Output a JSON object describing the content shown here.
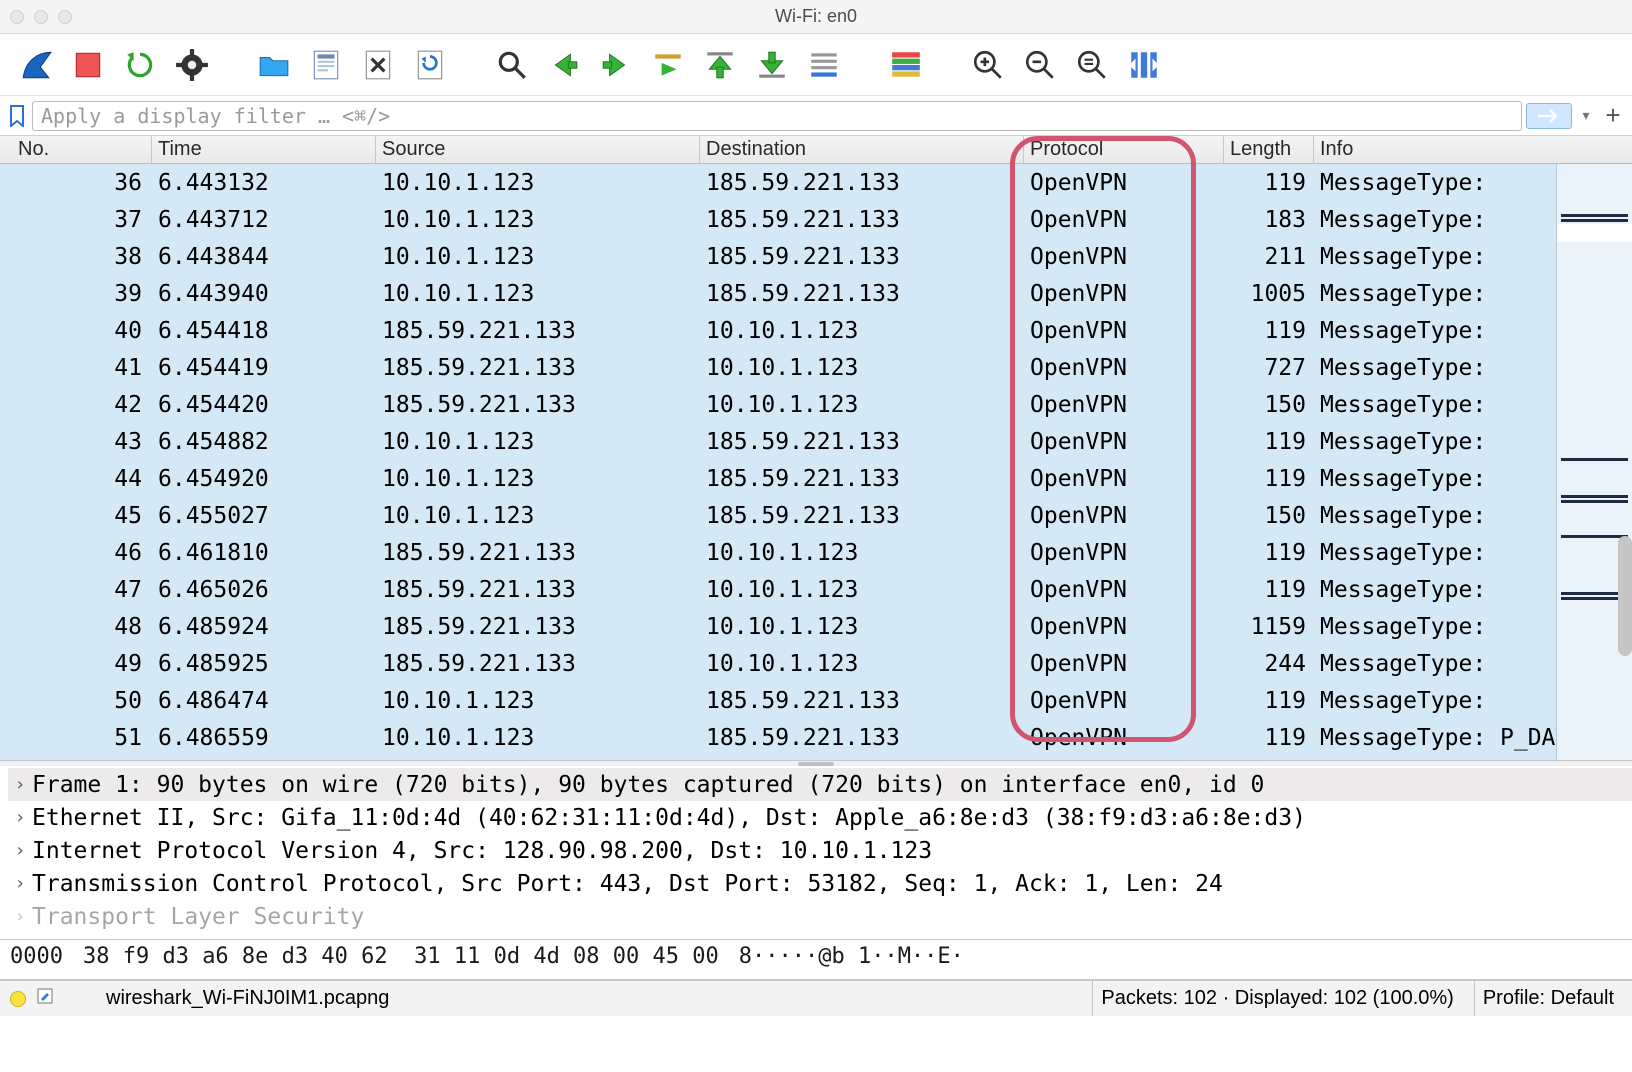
{
  "window": {
    "title": "Wi-Fi: en0"
  },
  "filter": {
    "placeholder": "Apply a display filter … <⌘/>"
  },
  "columns": {
    "no": "No.",
    "time": "Time",
    "source": "Source",
    "destination": "Destination",
    "protocol": "Protocol",
    "length": "Length",
    "info": "Info"
  },
  "packets": [
    {
      "no": 36,
      "time": "6.443132",
      "src": "10.10.1.123",
      "dst": "185.59.221.133",
      "proto": "OpenVPN",
      "len": 119,
      "info": "MessageType:"
    },
    {
      "no": 37,
      "time": "6.443712",
      "src": "10.10.1.123",
      "dst": "185.59.221.133",
      "proto": "OpenVPN",
      "len": 183,
      "info": "MessageType:"
    },
    {
      "no": 38,
      "time": "6.443844",
      "src": "10.10.1.123",
      "dst": "185.59.221.133",
      "proto": "OpenVPN",
      "len": 211,
      "info": "MessageType:"
    },
    {
      "no": 39,
      "time": "6.443940",
      "src": "10.10.1.123",
      "dst": "185.59.221.133",
      "proto": "OpenVPN",
      "len": 1005,
      "info": "MessageType:"
    },
    {
      "no": 40,
      "time": "6.454418",
      "src": "185.59.221.133",
      "dst": "10.10.1.123",
      "proto": "OpenVPN",
      "len": 119,
      "info": "MessageType:"
    },
    {
      "no": 41,
      "time": "6.454419",
      "src": "185.59.221.133",
      "dst": "10.10.1.123",
      "proto": "OpenVPN",
      "len": 727,
      "info": "MessageType:"
    },
    {
      "no": 42,
      "time": "6.454420",
      "src": "185.59.221.133",
      "dst": "10.10.1.123",
      "proto": "OpenVPN",
      "len": 150,
      "info": "MessageType:"
    },
    {
      "no": 43,
      "time": "6.454882",
      "src": "10.10.1.123",
      "dst": "185.59.221.133",
      "proto": "OpenVPN",
      "len": 119,
      "info": "MessageType:"
    },
    {
      "no": 44,
      "time": "6.454920",
      "src": "10.10.1.123",
      "dst": "185.59.221.133",
      "proto": "OpenVPN",
      "len": 119,
      "info": "MessageType:"
    },
    {
      "no": 45,
      "time": "6.455027",
      "src": "10.10.1.123",
      "dst": "185.59.221.133",
      "proto": "OpenVPN",
      "len": 150,
      "info": "MessageType:"
    },
    {
      "no": 46,
      "time": "6.461810",
      "src": "185.59.221.133",
      "dst": "10.10.1.123",
      "proto": "OpenVPN",
      "len": 119,
      "info": "MessageType:"
    },
    {
      "no": 47,
      "time": "6.465026",
      "src": "185.59.221.133",
      "dst": "10.10.1.123",
      "proto": "OpenVPN",
      "len": 119,
      "info": "MessageType:"
    },
    {
      "no": 48,
      "time": "6.485924",
      "src": "185.59.221.133",
      "dst": "10.10.1.123",
      "proto": "OpenVPN",
      "len": 1159,
      "info": "MessageType:"
    },
    {
      "no": 49,
      "time": "6.485925",
      "src": "185.59.221.133",
      "dst": "10.10.1.123",
      "proto": "OpenVPN",
      "len": 244,
      "info": "MessageType:"
    },
    {
      "no": 50,
      "time": "6.486474",
      "src": "10.10.1.123",
      "dst": "185.59.221.133",
      "proto": "OpenVPN",
      "len": 119,
      "info": "MessageType:"
    },
    {
      "no": 51,
      "time": "6.486559",
      "src": "10.10.1.123",
      "dst": "185.59.221.133",
      "proto": "OpenVPN",
      "len": 119,
      "info": "MessageType: P_DATA"
    }
  ],
  "detail": [
    "Frame 1: 90 bytes on wire (720 bits), 90 bytes captured (720 bits) on interface en0, id 0",
    "Ethernet II, Src: Gifa_11:0d:4d (40:62:31:11:0d:4d), Dst: Apple_a6:8e:d3 (38:f9:d3:a6:8e:d3)",
    "Internet Protocol Version 4, Src: 128.90.98.200, Dst: 10.10.1.123",
    "Transmission Control Protocol, Src Port: 443, Dst Port: 53182, Seq: 1, Ack: 1, Len: 24",
    "Transport Layer Security"
  ],
  "hex": {
    "addr": "0000",
    "bytes": "38 f9 d3 a6 8e d3 40 62  31 11 0d 4d 08 00 45 00",
    "ascii": "8·····@b 1··M··E·"
  },
  "status": {
    "file": "wireshark_Wi-FiNJ0IM1.pcapng",
    "packets": "Packets: 102 · Displayed: 102 (100.0%)",
    "profile": "Profile: Default"
  },
  "icons": {
    "fin": "shark-fin-icon",
    "stop": "stop-icon",
    "restart": "restart-icon",
    "options": "gear-icon",
    "open": "folder-open-icon",
    "save": "save-file-icon",
    "close": "close-file-icon",
    "reload": "reload-file-icon",
    "find": "find-icon",
    "prev": "prev-arrow-icon",
    "next": "next-arrow-icon",
    "jump": "jump-to-icon",
    "first": "go-first-icon",
    "last": "go-last-icon",
    "auto": "auto-scroll-icon",
    "colorize": "colorize-icon",
    "zin": "zoom-in-icon",
    "zout": "zoom-out-icon",
    "zreset": "zoom-reset-icon",
    "resize": "resize-columns-icon"
  }
}
